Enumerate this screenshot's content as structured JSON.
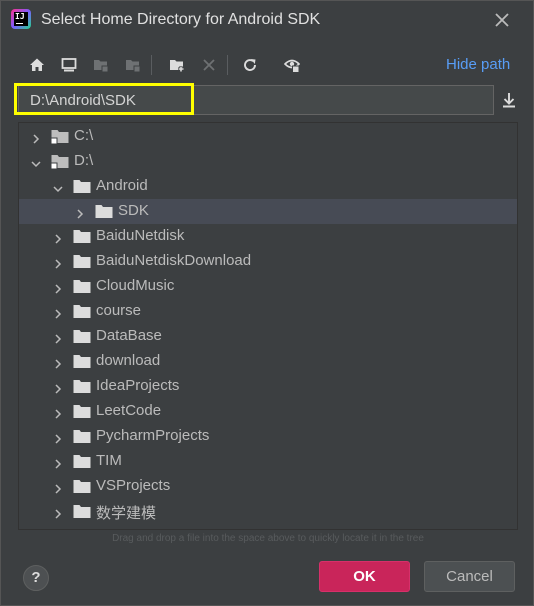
{
  "window": {
    "title": "Select Home Directory for Android SDK"
  },
  "toolbar": {
    "hide_path_label": "Hide path"
  },
  "path": {
    "value": "D:\\Android\\SDK"
  },
  "tree": {
    "items": [
      {
        "label": "C:\\",
        "level": 0,
        "expanded": false,
        "drive": true
      },
      {
        "label": "D:\\",
        "level": 0,
        "expanded": true,
        "drive": true
      },
      {
        "label": "Android",
        "level": 1,
        "expanded": true
      },
      {
        "label": "SDK",
        "level": 2,
        "expanded": false,
        "selected": true
      },
      {
        "label": "BaiduNetdisk",
        "level": 1,
        "expanded": false
      },
      {
        "label": "BaiduNetdiskDownload",
        "level": 1,
        "expanded": false
      },
      {
        "label": "CloudMusic",
        "level": 1,
        "expanded": false
      },
      {
        "label": "course",
        "level": 1,
        "expanded": false
      },
      {
        "label": "DataBase",
        "level": 1,
        "expanded": false
      },
      {
        "label": "download",
        "level": 1,
        "expanded": false
      },
      {
        "label": "IdeaProjects",
        "level": 1,
        "expanded": false
      },
      {
        "label": "LeetCode",
        "level": 1,
        "expanded": false
      },
      {
        "label": "PycharmProjects",
        "level": 1,
        "expanded": false
      },
      {
        "label": "TIM",
        "level": 1,
        "expanded": false
      },
      {
        "label": "VSProjects",
        "level": 1,
        "expanded": false
      },
      {
        "label": "数学建模",
        "level": 1,
        "expanded": false
      }
    ]
  },
  "hint": "Drag and drop a file into the space above to quickly locate it in the tree",
  "footer": {
    "help_label": "?",
    "ok_label": "OK",
    "cancel_label": "Cancel"
  },
  "colors": {
    "accent": "#589df6",
    "ok": "#c9255a",
    "highlight": "#ffff00",
    "selected_row": "#474b55"
  }
}
